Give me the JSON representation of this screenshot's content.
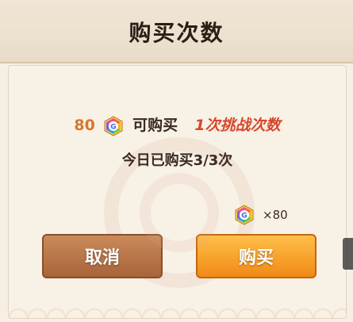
{
  "dialog": {
    "title": "购买次数",
    "cost_amount": "80",
    "can_buy_label": "可购买",
    "reward_text": "1次挑战次数",
    "today_purchased": "今日已购买3/3次",
    "price_multiplier": "×80",
    "cancel_label": "取消",
    "buy_label": "购买",
    "gem_icon": "rainbow-gem-icon"
  },
  "colors": {
    "cost_number": "#d8762a",
    "highlight": "#d8462a",
    "cancel_button": "#b2703f",
    "buy_button": "#f59a22"
  }
}
